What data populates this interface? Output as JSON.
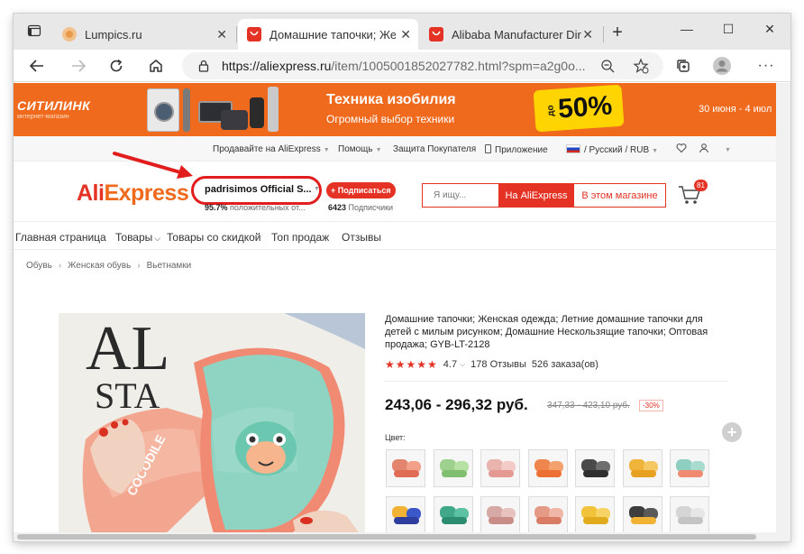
{
  "browser": {
    "tabs": [
      {
        "title": "Lumpics.ru",
        "icon": "lumpics-favicon-icon"
      },
      {
        "title": "Домашние тапочки; Жен",
        "icon": "aliexpress-favicon-icon"
      },
      {
        "title": "Alibaba Manufacturer Dir",
        "icon": "aliexpress-favicon-icon"
      }
    ],
    "url_host": "https://aliexpress.ru",
    "url_path": "/item/1005001852027782.html?spm=a2g0o..."
  },
  "banner": {
    "logo": "СИТИЛИНК",
    "logo_sub": "интернет-магазин",
    "title": "Техника изобилия",
    "subtitle": "Огромный выбор техники",
    "promo_prefix": "до",
    "promo_value": "50%",
    "dates": "30 июня - 4 июл"
  },
  "topnav": {
    "sell": "Продавайте на AliExpress",
    "help": "Помощь",
    "buyer_protection": "Защита Покупателя",
    "app": "Приложение",
    "locale": "/ Русский / RUB"
  },
  "header": {
    "logo_ali": "Ali",
    "logo_express": "Express",
    "store_name": "padrisimos Official S...",
    "follow_label": "+ Подписаться",
    "rating_value": "95.7%",
    "rating_text": "положительных от...",
    "followers_count": "6423",
    "followers_label": "Подписчики",
    "search_placeholder": "Я ищу...",
    "search_ali": "На AliExpress",
    "search_store": "В этом магазине",
    "cart_count": "81"
  },
  "storenav": {
    "items": [
      "Главная страница",
      "Товары",
      "Товары со скидкой",
      "Топ продаж",
      "Отзывы"
    ]
  },
  "breadcrumb": [
    "Обувь",
    "Женская обувь",
    "Вьетнамки"
  ],
  "product": {
    "title": "Домашние тапочки; Женская одежда; Летние домашние тапочки для детей с милым рисунком; Домашние Нескользящие тапочки; Оптовая продажа; GYB-LT-2128",
    "rating": "4.7",
    "reviews": "178 Отзывы",
    "orders": "526 заказа(ов)",
    "price": "243,06 - 296,32 руб.",
    "old_price": "347,33 - 423,10 руб.",
    "discount": "-30%",
    "color_label": "Цвет:",
    "image_text_top": "AL",
    "image_text_mid": "STA",
    "image_text_side": "COCODILE",
    "swatches": [
      {
        "c1": "#e2846e",
        "c2": "#f2a08a",
        "sole": "#e06c56"
      },
      {
        "c1": "#9fd18e",
        "c2": "#b6e0a4",
        "sole": "#7fbf6f"
      },
      {
        "c1": "#e9b3ae",
        "c2": "#f3cac5",
        "sole": "#e49a93"
      },
      {
        "c1": "#f0864f",
        "c2": "#f4a16e",
        "sole": "#ec6f33"
      },
      {
        "c1": "#4a4a4a",
        "c2": "#6e6e6e",
        "sole": "#2f2f2f"
      },
      {
        "c1": "#f0b43b",
        "c2": "#f5c864",
        "sole": "#e7a020"
      },
      {
        "c1": "#8fcfc1",
        "c2": "#a9dccf",
        "sole": "#f08b72"
      },
      {
        "c1": "#f2b234",
        "c2": "#3a58c8",
        "sole": "#2d3e9e"
      },
      {
        "c1": "#41a88a",
        "c2": "#5cc0a2",
        "sole": "#2c8c70"
      },
      {
        "c1": "#d7a9a4",
        "c2": "#e8c2be",
        "sole": "#c98c86"
      },
      {
        "c1": "#e59a86",
        "c2": "#f0b6a7",
        "sole": "#d97c65"
      },
      {
        "c1": "#f2c23a",
        "c2": "#f6d364",
        "sole": "#e2aa1d"
      },
      {
        "c1": "#3d3d3d",
        "c2": "#5a5a5a",
        "sole": "#f2b234"
      },
      {
        "c1": "#d5d5d5",
        "c2": "#e6e6e6",
        "sole": "#c4c4c4"
      }
    ]
  },
  "colors": {
    "accent": "#e43225",
    "banner": "#f06a1e",
    "annotation": "#e21d1d"
  }
}
